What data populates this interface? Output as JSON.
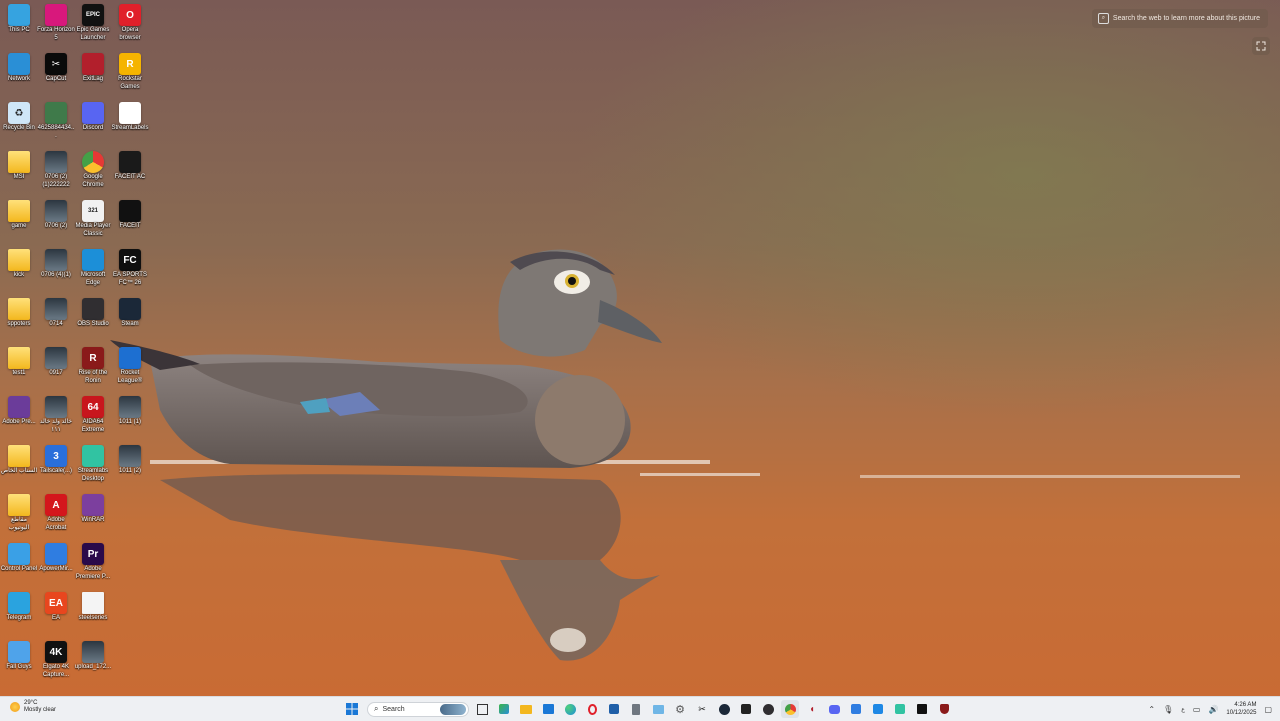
{
  "desktop": {
    "icons": [
      {
        "label": "This PC",
        "icon": "this-pc-icon",
        "glyph": "",
        "bg": "#36a3e0",
        "kind": "app"
      },
      {
        "label": "Forza Horizon 5",
        "icon": "forza-icon",
        "glyph": "",
        "bg": "#d8187c",
        "kind": "app"
      },
      {
        "label": "Epic Games Launcher",
        "icon": "epic-games-icon",
        "glyph": "EPIC",
        "bg": "#111111",
        "kind": "app"
      },
      {
        "label": "Opera browser",
        "icon": "opera-icon",
        "glyph": "O",
        "bg": "#e0202a",
        "kind": "app"
      },
      {
        "label": "Network",
        "icon": "network-icon",
        "glyph": "",
        "bg": "#2a8fd6",
        "kind": "app"
      },
      {
        "label": "CapCut",
        "icon": "capcut-icon",
        "glyph": "✂",
        "bg": "#0a0a0a",
        "kind": "app"
      },
      {
        "label": "ExitLag",
        "icon": "exitlag-icon",
        "glyph": "",
        "bg": "#b21f2c",
        "kind": "app"
      },
      {
        "label": "Rockstar Games",
        "icon": "rockstar-icon",
        "glyph": "R",
        "bg": "#f5b400",
        "kind": "app"
      },
      {
        "label": "Recycle Bin",
        "icon": "recycle-bin-icon",
        "glyph": "♻",
        "bg": "#cfe6f7",
        "kind": "app"
      },
      {
        "label": "4625884434...",
        "icon": "image-file-icon",
        "glyph": "",
        "bg": "#3f7a4a",
        "kind": "app"
      },
      {
        "label": "Discord",
        "icon": "discord-icon",
        "glyph": "",
        "bg": "#5865f2",
        "kind": "app"
      },
      {
        "label": "StreamLabels",
        "icon": "streamlabels-icon",
        "glyph": "",
        "bg": "#ffffff",
        "kind": "app"
      },
      {
        "label": "MSI",
        "icon": "folder-icon",
        "glyph": "",
        "bg": "",
        "kind": "folder"
      },
      {
        "label": "0706 (2)(1)222222",
        "icon": "video-file-icon",
        "glyph": "",
        "bg": "",
        "kind": "video"
      },
      {
        "label": "Google Chrome",
        "icon": "chrome-icon",
        "glyph": "",
        "bg": "#ffffff",
        "kind": "chrome"
      },
      {
        "label": "FACEIT AC",
        "icon": "faceit-ac-icon",
        "glyph": "",
        "bg": "#1a1a1a",
        "kind": "app"
      },
      {
        "label": "game",
        "icon": "folder-icon",
        "glyph": "",
        "bg": "",
        "kind": "folder"
      },
      {
        "label": "0706 (2)",
        "icon": "video-file-icon",
        "glyph": "",
        "bg": "",
        "kind": "video"
      },
      {
        "label": "Media Player Classic",
        "icon": "mpc-icon",
        "glyph": "321",
        "bg": "#f1f1f1",
        "kind": "app"
      },
      {
        "label": "FACEIT",
        "icon": "faceit-icon",
        "glyph": "",
        "bg": "#111111",
        "kind": "app"
      },
      {
        "label": "kick",
        "icon": "folder-icon",
        "glyph": "",
        "bg": "",
        "kind": "folder"
      },
      {
        "label": "0706 (4)(1)",
        "icon": "video-file-icon",
        "glyph": "",
        "bg": "",
        "kind": "video"
      },
      {
        "label": "Microsoft Edge",
        "icon": "edge-icon",
        "glyph": "",
        "bg": "#1c8fd8",
        "kind": "app"
      },
      {
        "label": "EA SPORTS FC™ 26",
        "icon": "ea-fc-icon",
        "glyph": "FC",
        "bg": "#0f0f0f",
        "kind": "app"
      },
      {
        "label": "sppoters",
        "icon": "folder-icon",
        "glyph": "",
        "bg": "",
        "kind": "folder"
      },
      {
        "label": "0714",
        "icon": "video-file-icon",
        "glyph": "",
        "bg": "",
        "kind": "video"
      },
      {
        "label": "OBS Studio",
        "icon": "obs-icon",
        "glyph": "",
        "bg": "#302e31",
        "kind": "app"
      },
      {
        "label": "Steam",
        "icon": "steam-icon",
        "glyph": "",
        "bg": "#1b2838",
        "kind": "app"
      },
      {
        "label": "test1",
        "icon": "folder-icon",
        "glyph": "",
        "bg": "",
        "kind": "folder"
      },
      {
        "label": "0917",
        "icon": "video-file-icon",
        "glyph": "",
        "bg": "",
        "kind": "video"
      },
      {
        "label": "Rise of the Ronin",
        "icon": "ronin-icon",
        "glyph": "R",
        "bg": "#8a1a1a",
        "kind": "app"
      },
      {
        "label": "Rocket League®",
        "icon": "rocket-league-icon",
        "glyph": "",
        "bg": "#1d6fd1",
        "kind": "app"
      },
      {
        "label": "Adobe Pre...",
        "icon": "winrar-style-icon",
        "glyph": "",
        "bg": "#6b3c9a",
        "kind": "app"
      },
      {
        "label": "خالد ولد خالد ١١١",
        "icon": "video-file-icon",
        "glyph": "",
        "bg": "",
        "kind": "video"
      },
      {
        "label": "AIDA64 Extreme",
        "icon": "aida64-icon",
        "glyph": "64",
        "bg": "#c8161d",
        "kind": "app"
      },
      {
        "label": "1011 (1)",
        "icon": "video-file-icon",
        "glyph": "",
        "bg": "",
        "kind": "video"
      },
      {
        "label": "السناب الخاص",
        "icon": "folder-icon",
        "glyph": "",
        "bg": "",
        "kind": "folder"
      },
      {
        "label": "Tailscale(...)",
        "icon": "tailscale-icon",
        "glyph": "3",
        "bg": "#2a6fdb",
        "kind": "app"
      },
      {
        "label": "Streamlabs Desktop",
        "icon": "streamlabs-icon",
        "glyph": "",
        "bg": "#31c3a2",
        "kind": "app"
      },
      {
        "label": "1011 (2)",
        "icon": "video-file-icon",
        "glyph": "",
        "bg": "",
        "kind": "video"
      },
      {
        "label": "مقاطع اليوتيوب",
        "icon": "folder-icon",
        "glyph": "",
        "bg": "",
        "kind": "folder"
      },
      {
        "label": "Adobe Acrobat",
        "icon": "acrobat-icon",
        "glyph": "A",
        "bg": "#d4161c",
        "kind": "app"
      },
      {
        "label": "WinRAR",
        "icon": "winrar-icon",
        "glyph": "",
        "bg": "#7c3f9e",
        "kind": "app"
      },
      {
        "label": "Control Panel",
        "icon": "control-panel-icon",
        "glyph": "",
        "bg": "#3aa0e6",
        "kind": "app"
      },
      {
        "label": "ApowerMir...",
        "icon": "apowermirror-icon",
        "glyph": "",
        "bg": "#2f7de1",
        "kind": "app"
      },
      {
        "label": "Adobe Premiere P...",
        "icon": "premiere-icon",
        "glyph": "Pr",
        "bg": "#2a0a4a",
        "kind": "app"
      },
      {
        "label": "Telegram",
        "icon": "telegram-icon",
        "glyph": "",
        "bg": "#2aa3df",
        "kind": "app"
      },
      {
        "label": "EA",
        "icon": "ea-icon",
        "glyph": "EA",
        "bg": "#e8461e",
        "kind": "app"
      },
      {
        "label": "steelseries",
        "icon": "file-icon",
        "glyph": "",
        "bg": "",
        "kind": "file"
      },
      {
        "label": "Fall Guys",
        "icon": "fall-guys-icon",
        "glyph": "",
        "bg": "#4fa3ea",
        "kind": "app"
      },
      {
        "label": "Elgato 4K Capture...",
        "icon": "elgato-icon",
        "glyph": "4K",
        "bg": "#111111",
        "kind": "app"
      },
      {
        "label": "upload_172...",
        "icon": "video-file-icon",
        "glyph": "",
        "bg": "",
        "kind": "video"
      }
    ]
  },
  "lens": {
    "label": "Search the web to learn more about this picture"
  },
  "taskbar": {
    "weather_temp": "29°C",
    "weather_desc": "Mostly clear",
    "search_placeholder": "Search",
    "time": "4:26 AM",
    "date": "10/12/2025"
  }
}
